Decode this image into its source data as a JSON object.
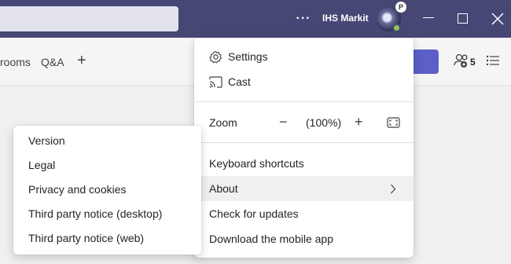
{
  "titlebar": {
    "more_label": "···",
    "org_name": "IHS Markit",
    "avatar_badge": "P"
  },
  "toolbar": {
    "tabs": [
      {
        "label": "rooms"
      },
      {
        "label": "Q&A"
      }
    ],
    "add_tab_label": "+",
    "participants_count": "5"
  },
  "menu": {
    "items": [
      {
        "label": "Settings",
        "icon": "gear-icon"
      },
      {
        "label": "Cast",
        "icon": "cast-icon"
      }
    ],
    "zoom": {
      "label": "Zoom",
      "decrease": "−",
      "value": "(100%)",
      "increase": "+"
    },
    "keyboard_shortcuts": "Keyboard shortcuts",
    "about": "About",
    "check_updates": "Check for updates",
    "download_app": "Download the mobile app"
  },
  "submenu": {
    "items": [
      {
        "label": "Version"
      },
      {
        "label": "Legal"
      },
      {
        "label": "Privacy and cookies"
      },
      {
        "label": "Third party notice (desktop)"
      },
      {
        "label": "Third party notice (web)"
      }
    ]
  }
}
